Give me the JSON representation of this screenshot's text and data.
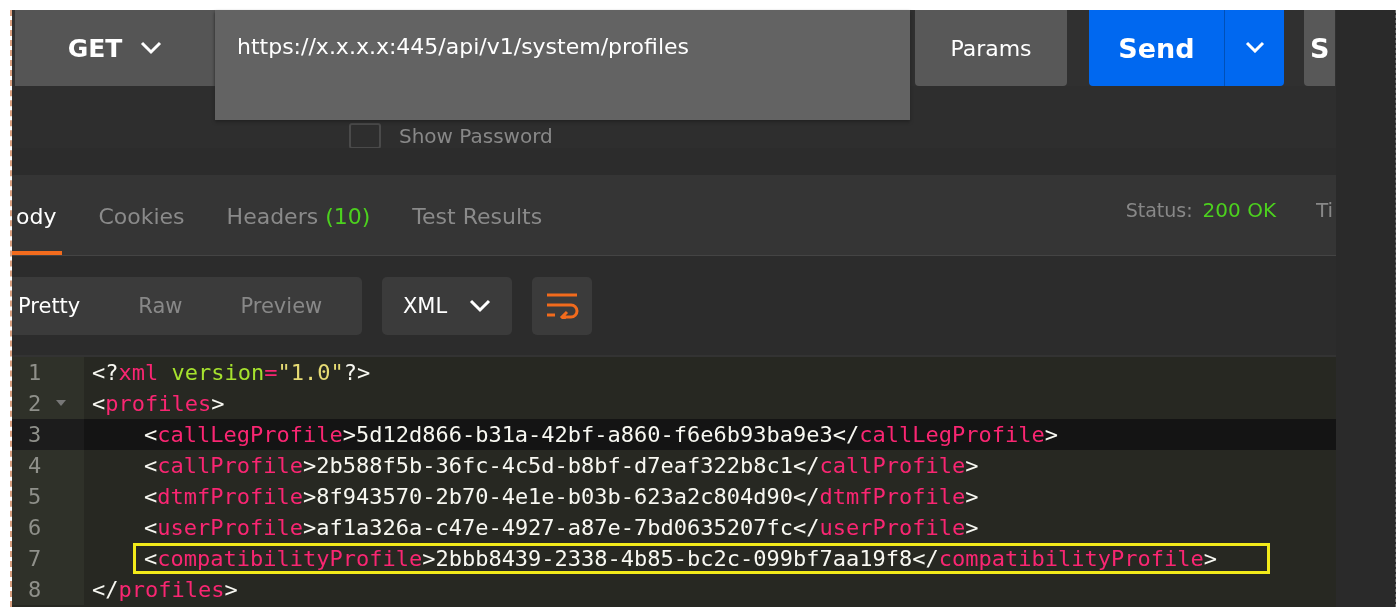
{
  "request": {
    "method": "GET",
    "url": "https://x.x.x.x:445/api/v1/system/profiles",
    "params_button": "Params",
    "send_button": "Send",
    "cut_button": "S"
  },
  "options": {
    "show_password": {
      "label": "Show Password",
      "checked": false
    }
  },
  "response_tabs": [
    {
      "label": "ody",
      "selected": true
    },
    {
      "label": "Cookies",
      "selected": false
    },
    {
      "label": "Headers",
      "count": "(10)",
      "selected": false
    },
    {
      "label": "Test Results",
      "selected": false
    }
  ],
  "status": {
    "label": "Status:",
    "value": "200 OK",
    "next_label": "Ti"
  },
  "view_modes": [
    {
      "label": "Pretty",
      "selected": true
    },
    {
      "label": "Raw",
      "selected": false
    },
    {
      "label": "Preview",
      "selected": false
    }
  ],
  "format": "XML",
  "code_lines": [
    {
      "number": "1",
      "foldable": false,
      "active": false,
      "boxed": false,
      "indent": false,
      "tokens": [
        {
          "kind": "punct",
          "text": "<?"
        },
        {
          "kind": "tag",
          "text": "xml"
        },
        {
          "kind": "attr",
          "text": " version"
        },
        {
          "kind": "tag",
          "text": "="
        },
        {
          "kind": "string",
          "text": "\"1.0\""
        },
        {
          "kind": "punct",
          "text": "?>"
        }
      ]
    },
    {
      "number": "2",
      "foldable": true,
      "active": false,
      "boxed": false,
      "indent": false,
      "tokens": [
        {
          "kind": "punct",
          "text": "<"
        },
        {
          "kind": "tag",
          "text": "profiles"
        },
        {
          "kind": "punct",
          "text": ">"
        }
      ]
    },
    {
      "number": "3",
      "foldable": false,
      "active": true,
      "boxed": false,
      "indent": true,
      "tokens": [
        {
          "kind": "punct",
          "text": "<"
        },
        {
          "kind": "tag",
          "text": "callLegProfile"
        },
        {
          "kind": "punct",
          "text": ">5d12d866-b31a-42bf-a860-f6e6b93ba9e3</"
        },
        {
          "kind": "tag",
          "text": "callLegProfile"
        },
        {
          "kind": "punct",
          "text": ">"
        }
      ]
    },
    {
      "number": "4",
      "foldable": false,
      "active": false,
      "boxed": false,
      "indent": true,
      "tokens": [
        {
          "kind": "punct",
          "text": "<"
        },
        {
          "kind": "tag",
          "text": "callProfile"
        },
        {
          "kind": "punct",
          "text": ">2b588f5b-36fc-4c5d-b8bf-d7eaf322b8c1</"
        },
        {
          "kind": "tag",
          "text": "callProfile"
        },
        {
          "kind": "punct",
          "text": ">"
        }
      ]
    },
    {
      "number": "5",
      "foldable": false,
      "active": false,
      "boxed": false,
      "indent": true,
      "tokens": [
        {
          "kind": "punct",
          "text": "<"
        },
        {
          "kind": "tag",
          "text": "dtmfProfile"
        },
        {
          "kind": "punct",
          "text": ">8f943570-2b70-4e1e-b03b-623a2c804d90</"
        },
        {
          "kind": "tag",
          "text": "dtmfProfile"
        },
        {
          "kind": "punct",
          "text": ">"
        }
      ]
    },
    {
      "number": "6",
      "foldable": false,
      "active": false,
      "boxed": false,
      "indent": true,
      "tokens": [
        {
          "kind": "punct",
          "text": "<"
        },
        {
          "kind": "tag",
          "text": "userProfile"
        },
        {
          "kind": "punct",
          "text": ">af1a326a-c47e-4927-a87e-7bd0635207fc</"
        },
        {
          "kind": "tag",
          "text": "userProfile"
        },
        {
          "kind": "punct",
          "text": ">"
        }
      ]
    },
    {
      "number": "7",
      "foldable": false,
      "active": false,
      "boxed": true,
      "indent": true,
      "tokens": [
        {
          "kind": "punct",
          "text": "<"
        },
        {
          "kind": "tag",
          "text": "compatibilityProfile"
        },
        {
          "kind": "punct",
          "text": ">2bbb8439-2338-4b85-bc2c-099bf7aa19f8</"
        },
        {
          "kind": "tag",
          "text": "compatibilityProfile"
        },
        {
          "kind": "punct",
          "text": ">"
        }
      ]
    },
    {
      "number": "8",
      "foldable": false,
      "active": false,
      "boxed": false,
      "indent": false,
      "tokens": [
        {
          "kind": "punct",
          "text": "</"
        },
        {
          "kind": "tag",
          "text": "profiles"
        },
        {
          "kind": "punct",
          "text": ">"
        }
      ]
    }
  ]
}
